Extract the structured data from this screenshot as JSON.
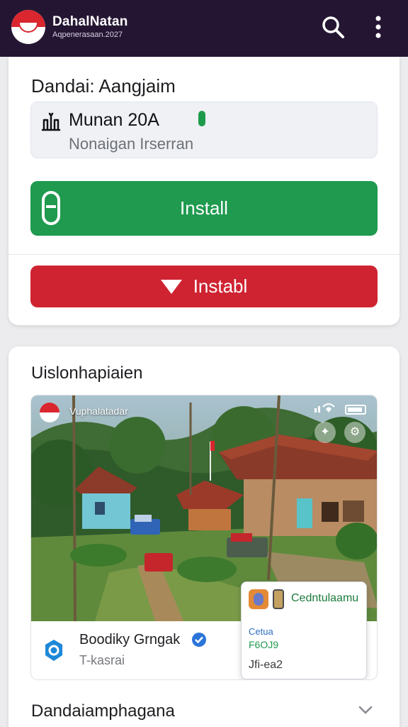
{
  "app_bar": {
    "title": "DahalNatan",
    "subtitle": "Aqpenerasaan.2027",
    "search_icon": "search-icon",
    "more_icon": "more-vertical-icon"
  },
  "install_card": {
    "title": "Dandai: Aangjaim",
    "app_info": {
      "name": "Munan 20A",
      "subtitle": "Nonaigan Irserran"
    },
    "primary_button": "Install",
    "secondary_button": "Instabl"
  },
  "feed_card": {
    "title": "Uislonhapiaien",
    "image_overlay": {
      "title": "Vuphalatadar"
    },
    "poster": {
      "name": "Boodiky Grngak",
      "meta": "T-kasrai"
    },
    "popup": {
      "title": "Cedntulaamu",
      "line1": "Cetua",
      "line2": "F6OJ9",
      "line3": "Jfi-ea2"
    },
    "footer_title": "Dandaiamphagana"
  },
  "colors": {
    "app_bar": "#241633",
    "install_green": "#1f9a4f",
    "install_red": "#cf2331",
    "background": "#ececee"
  }
}
